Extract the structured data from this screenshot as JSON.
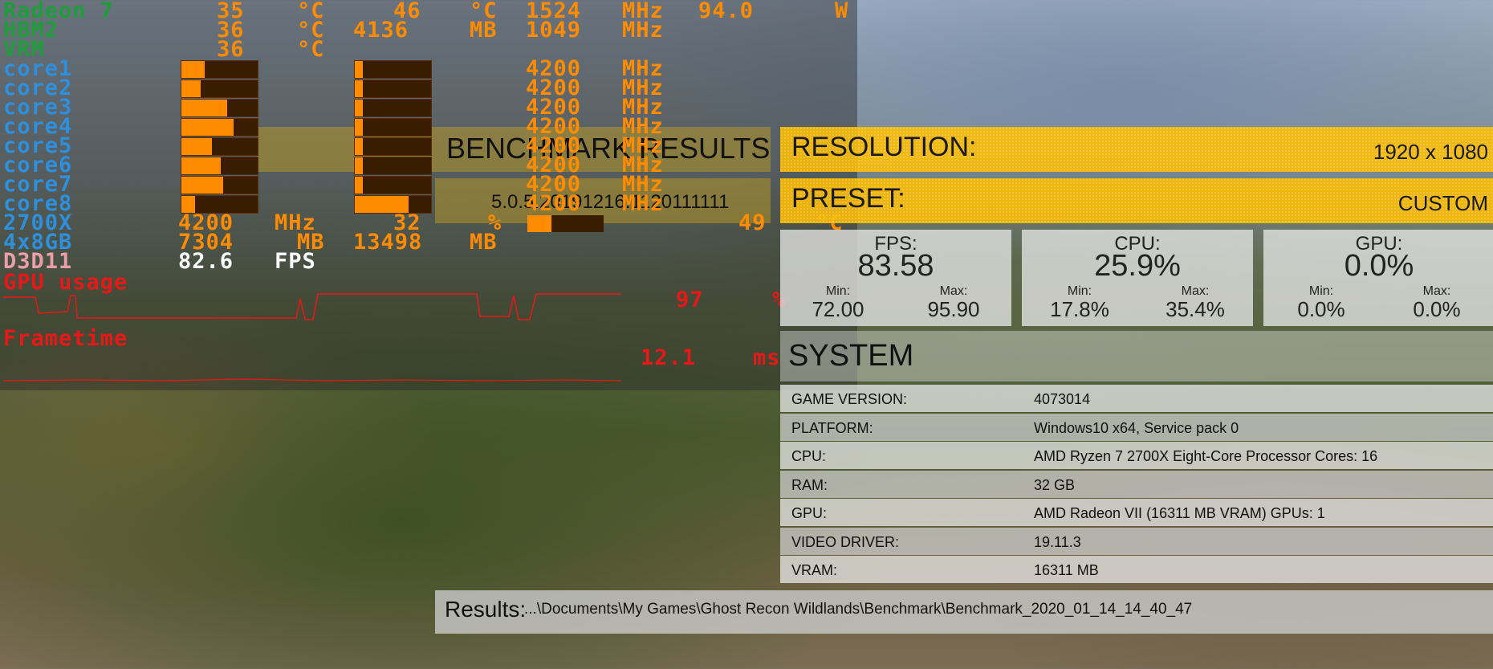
{
  "osd": {
    "gpu_name": "Radeon 7",
    "gpu_temp": "35",
    "gpu_temp_unit": "°C",
    "gpu_hotspot": "46",
    "gpu_hotspot_unit": "°C",
    "gpu_clock": "1524",
    "gpu_clock_unit": "MHz",
    "gpu_power": "94.0",
    "gpu_power_unit": "W",
    "hbm_label": "HBM2",
    "hbm_temp": "36",
    "hbm_temp_unit": "°C",
    "hbm_used": "4136",
    "hbm_used_unit": "MB",
    "hbm_clock": "1049",
    "hbm_clock_unit": "MHz",
    "vrm_label": "VRM",
    "vrm_temp": "36",
    "vrm_temp_unit": "°C",
    "cores": [
      {
        "label": "core1",
        "clock": "4200",
        "unit": "MHz",
        "usage": 0.3,
        "load": 0.1
      },
      {
        "label": "core2",
        "clock": "4200",
        "unit": "MHz",
        "usage": 0.25,
        "load": 0.1
      },
      {
        "label": "core3",
        "clock": "4200",
        "unit": "MHz",
        "usage": 0.6,
        "load": 0.1
      },
      {
        "label": "core4",
        "clock": "4200",
        "unit": "MHz",
        "usage": 0.68,
        "load": 0.1
      },
      {
        "label": "core5",
        "clock": "4200",
        "unit": "MHz",
        "usage": 0.4,
        "load": 0.1
      },
      {
        "label": "core6",
        "clock": "4200",
        "unit": "MHz",
        "usage": 0.52,
        "load": 0.1
      },
      {
        "label": "core7",
        "clock": "4200",
        "unit": "MHz",
        "usage": 0.55,
        "load": 0.1
      },
      {
        "label": "core8",
        "clock": "4200",
        "unit": "MHz",
        "usage": 0.18,
        "load": 0.7
      }
    ],
    "cpu_label": "2700X",
    "cpu_clock": "4200",
    "cpu_clock_unit": "MHz",
    "cpu_usage": "32",
    "cpu_usage_unit": "%",
    "cpu_usage_bar": 0.32,
    "cpu_temp": "49",
    "cpu_temp_unit": "°C",
    "ram_label": "4x8GB",
    "ram_used": "7304",
    "ram_used_unit": "MB",
    "ram_virtual": "13498",
    "ram_virtual_unit": "MB",
    "api_label": "D3D11",
    "fps": "82.6",
    "fps_unit": "FPS",
    "gpu_usage_label": "GPU usage",
    "gpu_usage_value": "97",
    "gpu_usage_unit": "%",
    "frametime_label": "Frametime",
    "frametime_value": "12.1",
    "frametime_unit": "ms"
  },
  "benchmark": {
    "results_title": "BENCHMARK RESULTS",
    "version_string": "5.0.5.20191216.1120111111",
    "resolution_label": "RESOLUTION:",
    "resolution_value": "1920 x 1080",
    "preset_label": "PRESET:",
    "preset_value": "CUSTOM"
  },
  "stats": [
    {
      "title": "FPS:",
      "value": "83.58",
      "min_label": "Min:",
      "min": "72.00",
      "max_label": "Max:",
      "max": "95.90"
    },
    {
      "title": "CPU:",
      "value": "25.9%",
      "min_label": "Min:",
      "min": "17.8%",
      "max_label": "Max:",
      "max": "35.4%"
    },
    {
      "title": "GPU:",
      "value": "0.0%",
      "min_label": "Min:",
      "min": "0.0%",
      "max_label": "Max:",
      "max": "0.0%"
    }
  ],
  "system": {
    "title": "SYSTEM",
    "rows": [
      {
        "key": "GAME VERSION:",
        "value": "4073014"
      },
      {
        "key": "PLATFORM:",
        "value": "Windows10 x64, Service pack 0"
      },
      {
        "key": "CPU:",
        "value": "AMD Ryzen 7 2700X Eight-Core Processor Cores: 16"
      },
      {
        "key": "RAM:",
        "value": "32 GB"
      },
      {
        "key": "GPU:",
        "value": "AMD Radeon VII (16311 MB VRAM) GPUs: 1"
      },
      {
        "key": "VIDEO DRIVER:",
        "value": "19.11.3"
      },
      {
        "key": "VRAM:",
        "value": "16311 MB"
      }
    ]
  },
  "results": {
    "label": "Results:",
    "path": "...\\Documents\\My Games\\Ghost Recon Wildlands\\Benchmark\\Benchmark_2020_01_14_14_40_47"
  },
  "colors": {
    "osd_orange": "#ff8c00",
    "osd_green": "#1f9d3a",
    "osd_blue": "#2e8fdc",
    "osd_red": "#e81818",
    "panel_yellow": "#ffbe00"
  }
}
